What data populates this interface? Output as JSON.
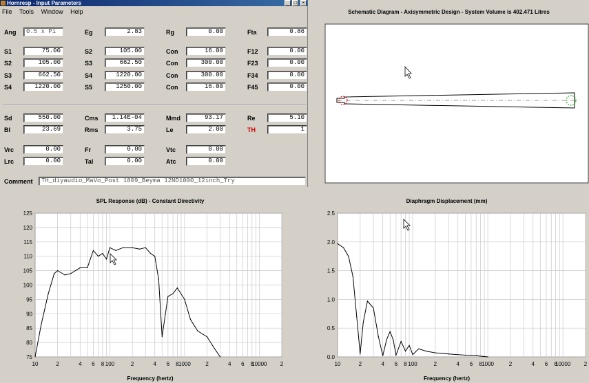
{
  "window": {
    "title": "Hornresp - Input Parameters",
    "controls": [
      "_",
      "□",
      "×"
    ]
  },
  "menu": [
    "File",
    "Tools",
    "Window",
    "Help"
  ],
  "params": {
    "row1": [
      {
        "label": "Ang",
        "value": "0.5 x Pi",
        "align": "left"
      },
      {
        "label": "Eg",
        "value": "2.83"
      },
      {
        "label": "Rg",
        "value": "0.00"
      },
      {
        "label": "Fta",
        "value": "0.86"
      }
    ],
    "rows": [
      [
        {
          "label": "S1",
          "value": "75.00"
        },
        {
          "label": "S2",
          "value": "105.00"
        },
        {
          "label": "Con",
          "value": "16.00"
        },
        {
          "label": "F12",
          "value": "0.00"
        }
      ],
      [
        {
          "label": "S2",
          "value": "105.00"
        },
        {
          "label": "S3",
          "value": "662.50"
        },
        {
          "label": "Con",
          "value": "300.00"
        },
        {
          "label": "F23",
          "value": "0.00"
        }
      ],
      [
        {
          "label": "S3",
          "value": "662.50"
        },
        {
          "label": "S4",
          "value": "1220.00"
        },
        {
          "label": "Con",
          "value": "300.00"
        },
        {
          "label": "F34",
          "value": "0.00"
        }
      ],
      [
        {
          "label": "S4",
          "value": "1220.00"
        },
        {
          "label": "S5",
          "value": "1250.00"
        },
        {
          "label": "Con",
          "value": "16.00"
        },
        {
          "label": "F45",
          "value": "0.00"
        }
      ]
    ],
    "driver1": [
      {
        "label": "Sd",
        "value": "550.00"
      },
      {
        "label": "Cms",
        "value": "1.14E-04"
      },
      {
        "label": "Mmd",
        "value": "93.17"
      },
      {
        "label": "Re",
        "value": "5.10"
      }
    ],
    "driver2": [
      {
        "label": "Bl",
        "value": "23.69"
      },
      {
        "label": "Rms",
        "value": "3.75"
      },
      {
        "label": "Le",
        "value": "2.00"
      },
      {
        "label": "TH",
        "value": "1"
      }
    ],
    "chamber1": [
      {
        "label": "Vrc",
        "value": "0.00"
      },
      {
        "label": "Fr",
        "value": "0.00"
      },
      {
        "label": "Vtc",
        "value": "0.00"
      }
    ],
    "chamber2": [
      {
        "label": "Lrc",
        "value": "0.00"
      },
      {
        "label": "Tal",
        "value": "0.00"
      },
      {
        "label": "Atc",
        "value": "0.00"
      }
    ],
    "comment_label": "Comment",
    "comment": "TH_diyaudio_MaVo_Post 1809_Beyma 12ND1000_12inch_Try"
  },
  "schematic": {
    "title": "Schematic Diagram - Axisymmetric Design - System Volume is 402.471 Litres"
  },
  "spl": {
    "title": "SPL Response (dB) - Constant Directivity",
    "xlabel": "Frequency (hertz)",
    "xticks": [
      "10",
      "2",
      "4",
      "6",
      "8",
      "100",
      "2",
      "4",
      "6",
      "8",
      "1000",
      "2",
      "4",
      "6",
      "8",
      "10000",
      "2"
    ],
    "yticks": [
      "125",
      "120",
      "115",
      "110",
      "105",
      "100",
      "95",
      "90",
      "85",
      "80",
      "75"
    ]
  },
  "disp": {
    "title": "Diaphragm Displacement (mm)",
    "xlabel": "Frequency (hertz)",
    "xticks": [
      "10",
      "2",
      "4",
      "6",
      "8",
      "100",
      "2",
      "4",
      "6",
      "8",
      "1000",
      "2",
      "4",
      "6",
      "8",
      "10000",
      "2"
    ],
    "yticks": [
      "2.5",
      "2.0",
      "1.5",
      "1.0",
      "0.5",
      "0.0"
    ]
  },
  "chart_data": [
    {
      "type": "line",
      "title": "SPL Response (dB) - Constant Directivity",
      "xlabel": "Frequency (hertz)",
      "ylabel": "",
      "xscale": "log",
      "xlim": [
        10,
        20000
      ],
      "ylim": [
        75,
        125
      ],
      "grid": true,
      "x": [
        10,
        12,
        15,
        18,
        20,
        25,
        30,
        40,
        50,
        60,
        70,
        80,
        90,
        100,
        120,
        150,
        200,
        250,
        300,
        350,
        400,
        450,
        500,
        600,
        700,
        800,
        1000,
        1200,
        1500,
        2000,
        2500,
        3000
      ],
      "y": [
        75,
        86,
        97,
        104,
        105,
        103.5,
        104,
        106,
        106,
        112,
        110,
        111,
        109,
        113,
        112,
        113,
        113,
        112.5,
        113,
        111,
        110,
        102,
        82,
        96,
        97,
        99,
        95,
        88,
        84,
        82,
        78,
        75
      ]
    },
    {
      "type": "line",
      "title": "Diaphragm Displacement (mm)",
      "xlabel": "Frequency (hertz)",
      "ylabel": "",
      "xscale": "log",
      "xlim": [
        10,
        20000
      ],
      "ylim": [
        0,
        2.5
      ],
      "grid": true,
      "x": [
        10,
        12,
        14,
        16,
        18,
        20,
        22,
        25,
        30,
        35,
        40,
        45,
        50,
        55,
        60,
        70,
        80,
        90,
        100,
        120,
        150,
        200,
        300,
        500,
        700,
        1000
      ],
      "y": [
        1.97,
        1.9,
        1.75,
        1.4,
        0.7,
        0.05,
        0.6,
        0.97,
        0.85,
        0.35,
        0.02,
        0.3,
        0.44,
        0.3,
        0.03,
        0.27,
        0.1,
        0.2,
        0.04,
        0.14,
        0.1,
        0.07,
        0.05,
        0.03,
        0.02,
        0.0
      ]
    }
  ]
}
